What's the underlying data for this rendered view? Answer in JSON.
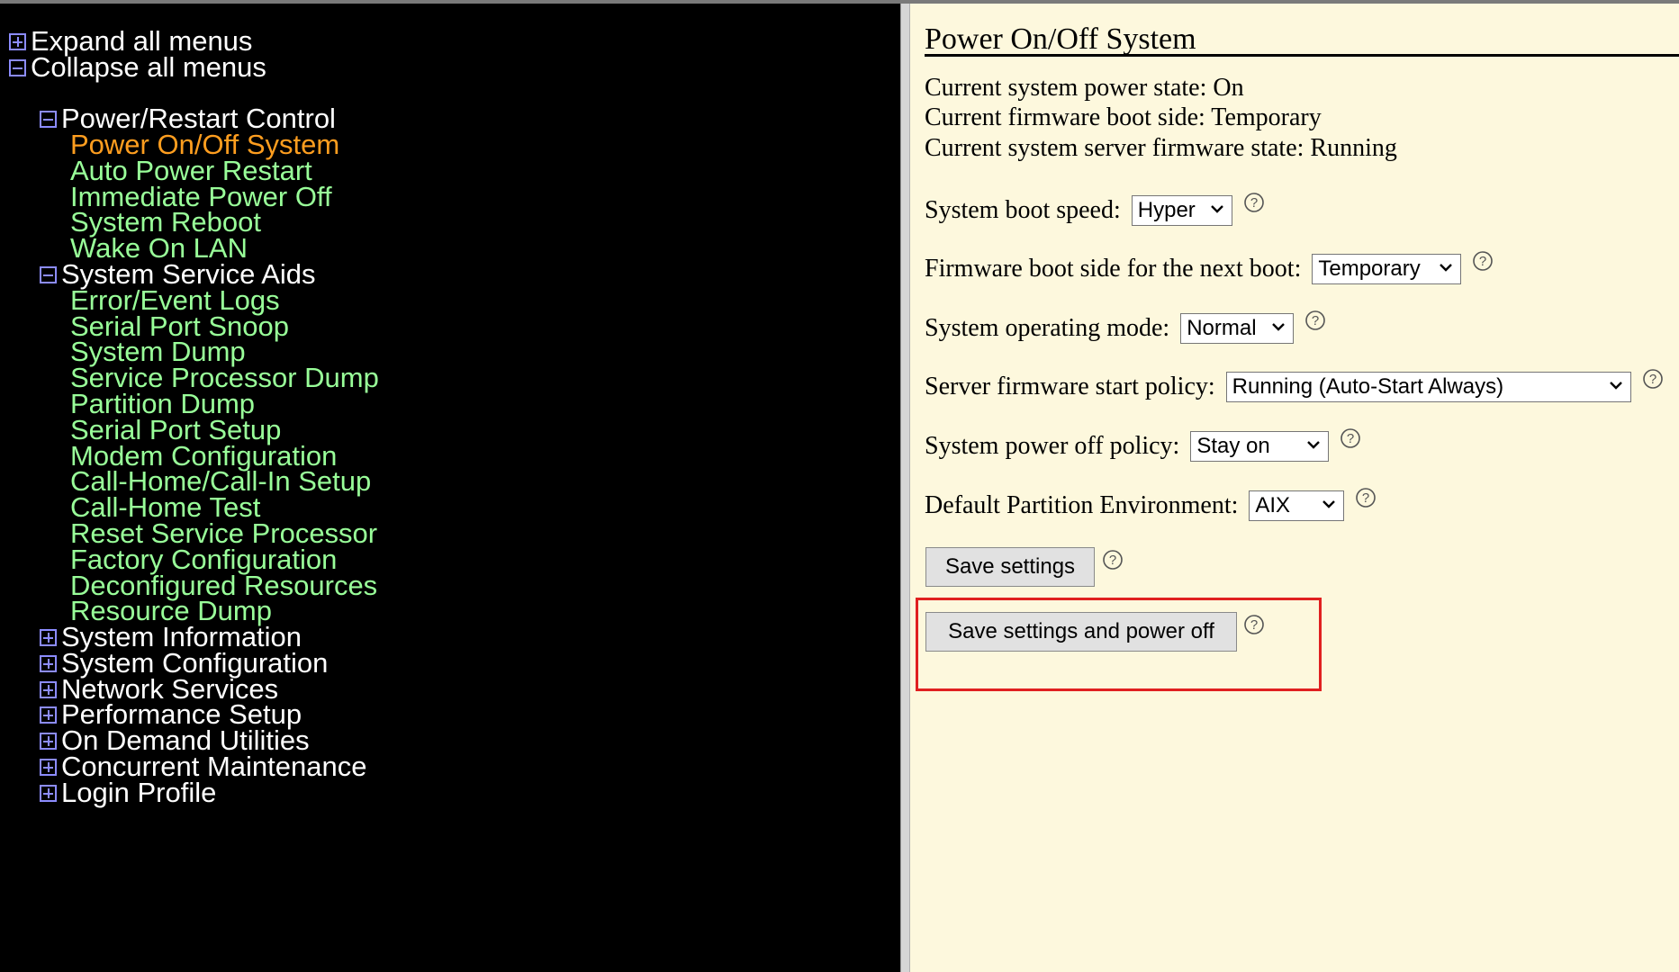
{
  "nav": {
    "expand_all": "Expand all menus",
    "collapse_all": "Collapse all menus",
    "groups": [
      {
        "label": "Power/Restart Control",
        "expanded": true,
        "items": [
          "Power On/Off System",
          "Auto Power Restart",
          "Immediate Power Off",
          "System Reboot",
          "Wake On LAN"
        ],
        "active_item": "Power On/Off System"
      },
      {
        "label": "System Service Aids",
        "expanded": true,
        "items": [
          "Error/Event Logs",
          "Serial Port Snoop",
          "System Dump",
          "Service Processor Dump",
          "Partition Dump",
          "Serial Port Setup",
          "Modem Configuration",
          "Call-Home/Call-In Setup",
          "Call-Home Test",
          "Reset Service Processor",
          "Factory Configuration",
          "Deconfigured Resources",
          "Resource Dump"
        ]
      },
      {
        "label": "System Information",
        "expanded": false
      },
      {
        "label": "System Configuration",
        "expanded": false
      },
      {
        "label": "Network Services",
        "expanded": false
      },
      {
        "label": "Performance Setup",
        "expanded": false
      },
      {
        "label": "On Demand Utilities",
        "expanded": false
      },
      {
        "label": "Concurrent Maintenance",
        "expanded": false
      },
      {
        "label": "Login Profile",
        "expanded": false
      }
    ]
  },
  "content": {
    "title": "Power On/Off System",
    "status": [
      "Current system power state: On",
      "Current firmware boot side: Temporary",
      "Current system server firmware state: Running"
    ],
    "fields": [
      {
        "label": "System boot speed:",
        "value": "Hyper"
      },
      {
        "label": "Firmware boot side for the next boot:",
        "value": "Temporary"
      },
      {
        "label": "System operating mode:",
        "value": "Normal"
      },
      {
        "label": "Server firmware start policy:",
        "value": "Running (Auto-Start Always)"
      },
      {
        "label": "System power off policy:",
        "value": "Stay on"
      },
      {
        "label": "Default Partition Environment:",
        "value": "AIX"
      }
    ],
    "save_button": "Save settings",
    "save_power_off_button": "Save settings and power off"
  },
  "colors": {
    "nav_background": "#000000",
    "nav_link": "#99ff99",
    "nav_active": "#ff9e1f",
    "nav_icon": "#8c8cff",
    "content_background": "#fdf8dd",
    "highlight": "#e02020"
  },
  "icons": {
    "expand": "plus-box-icon",
    "collapse": "minus-box-icon",
    "help": "question-circle-icon",
    "dropdown": "chevron-down-icon"
  }
}
